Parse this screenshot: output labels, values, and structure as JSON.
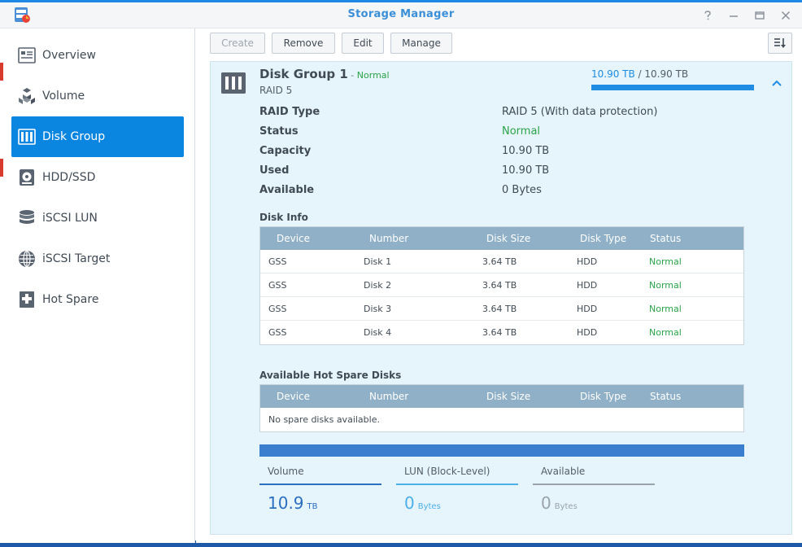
{
  "window": {
    "title": "Storage Manager",
    "controls": [
      "help-icon",
      "minimize-icon",
      "maximize-icon",
      "close-icon"
    ]
  },
  "sidebar": {
    "items": [
      {
        "label": "Overview",
        "icon": "overview-icon",
        "active": false
      },
      {
        "label": "Volume",
        "icon": "volume-icon",
        "active": false
      },
      {
        "label": "Disk Group",
        "icon": "disk-group-icon",
        "active": true
      },
      {
        "label": "HDD/SSD",
        "icon": "hdd-icon",
        "active": false
      },
      {
        "label": "iSCSI LUN",
        "icon": "iscsi-lun-icon",
        "active": false
      },
      {
        "label": "iSCSI Target",
        "icon": "iscsi-target-icon",
        "active": false
      },
      {
        "label": "Hot Spare",
        "icon": "hot-spare-icon",
        "active": false
      }
    ]
  },
  "toolbar": {
    "create_label": "Create",
    "remove_label": "Remove",
    "edit_label": "Edit",
    "manage_label": "Manage"
  },
  "disk_group": {
    "title": "Disk Group 1",
    "dash": " - ",
    "status": "Normal",
    "raid": "RAID 5",
    "capacity_used": "10.90 TB",
    "capacity_sep": " / ",
    "capacity_total": "10.90 TB",
    "capacity_fraction": 1.0,
    "properties": [
      {
        "key": "RAID Type",
        "value": "RAID 5 (With data protection)",
        "ok": false
      },
      {
        "key": "Status",
        "value": "Normal",
        "ok": true
      },
      {
        "key": "Capacity",
        "value": "10.90 TB",
        "ok": false
      },
      {
        "key": "Used",
        "value": "10.90 TB",
        "ok": false
      },
      {
        "key": "Available",
        "value": "0 Bytes",
        "ok": false
      }
    ]
  },
  "disk_info": {
    "title": "Disk Info",
    "columns": [
      "Device",
      "Number",
      "Disk Size",
      "Disk Type",
      "Status"
    ],
    "rows": [
      [
        "GSS",
        "Disk 1",
        "3.64 TB",
        "HDD",
        "Normal"
      ],
      [
        "GSS",
        "Disk 2",
        "3.64 TB",
        "HDD",
        "Normal"
      ],
      [
        "GSS",
        "Disk 3",
        "3.64 TB",
        "HDD",
        "Normal"
      ],
      [
        "GSS",
        "Disk 4",
        "3.64 TB",
        "HDD",
        "Normal"
      ]
    ]
  },
  "hot_spare": {
    "title": "Available Hot Spare Disks",
    "columns": [
      "Device",
      "Number",
      "Disk Size",
      "Disk Type",
      "Status"
    ],
    "empty_text": "No spare disks available."
  },
  "usage": {
    "stats": [
      {
        "label": "Volume",
        "value": "10.9",
        "unit": "TB",
        "color": "#2a6fc0",
        "line": "#2a6fc0"
      },
      {
        "label": "LUN (Block-Level)",
        "value": "0",
        "unit": "Bytes",
        "color": "#4cb0e8",
        "line": "#4cb0e8"
      },
      {
        "label": "Available",
        "value": "0",
        "unit": "Bytes",
        "color": "#9aa3ac",
        "line": "#9aa3ac"
      }
    ]
  }
}
